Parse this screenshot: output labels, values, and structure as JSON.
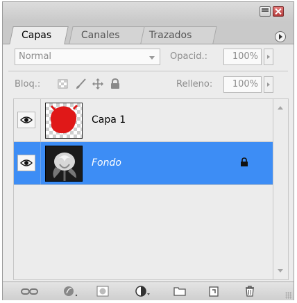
{
  "tabs": [
    {
      "label": "Capas",
      "active": true
    },
    {
      "label": "Canales",
      "active": false
    },
    {
      "label": "Trazados",
      "active": false
    }
  ],
  "blend": {
    "mode": "Normal",
    "opacity_label": "Opacid.:",
    "opacity_value": "100%"
  },
  "lock": {
    "label": "Bloq.:",
    "fill_label": "Relleno:",
    "fill_value": "100%"
  },
  "layers": [
    {
      "name": "Capa 1",
      "visible": true,
      "selected": false,
      "locked": false
    },
    {
      "name": "Fondo",
      "visible": true,
      "selected": true,
      "locked": true
    }
  ],
  "colors": {
    "selection": "#3d8df5",
    "panel_bg": "#ececec",
    "layer1_fill": "#e01818"
  },
  "icons": {
    "window": [
      "collapse-icon",
      "close-icon"
    ],
    "panel": [
      "panel-menu-icon"
    ],
    "lock": [
      "lock-transparency-icon",
      "lock-brush-icon",
      "lock-move-icon",
      "lock-all-icon"
    ],
    "toolbar": [
      "link-layers-icon",
      "layer-style-icon",
      "layer-mask-icon",
      "adjustment-layer-icon",
      "new-group-icon",
      "new-layer-icon",
      "delete-layer-icon"
    ]
  }
}
